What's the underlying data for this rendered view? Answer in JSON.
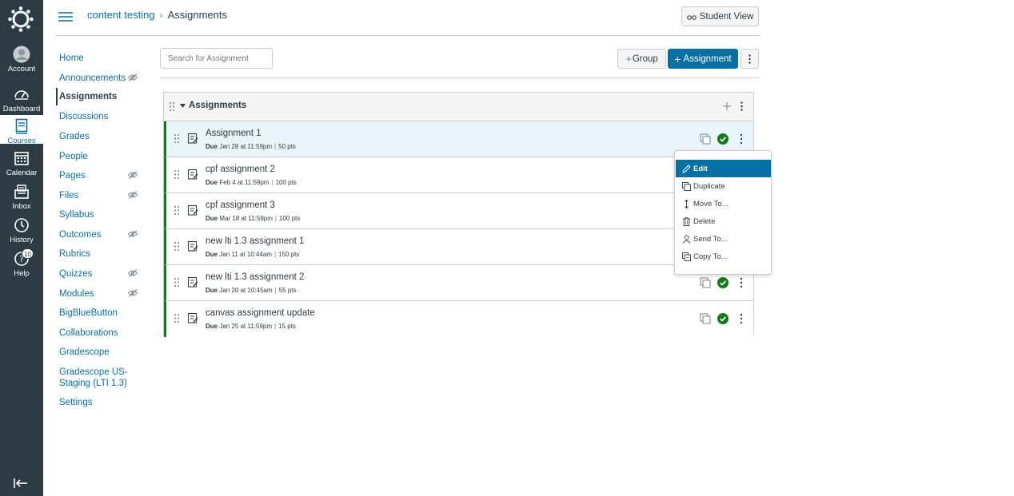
{
  "global_nav": {
    "items": [
      {
        "label": "Account",
        "icon": "account-icon"
      },
      {
        "label": "Dashboard",
        "icon": "dashboard-icon"
      },
      {
        "label": "Courses",
        "icon": "courses-icon",
        "active": true
      },
      {
        "label": "Calendar",
        "icon": "calendar-icon"
      },
      {
        "label": "Inbox",
        "icon": "inbox-icon"
      },
      {
        "label": "History",
        "icon": "history-icon"
      },
      {
        "label": "Help",
        "icon": "help-icon",
        "badge": "10"
      }
    ]
  },
  "header": {
    "course_name": "content testing",
    "separator": "›",
    "page": "Assignments",
    "student_view_label": "Student View"
  },
  "course_nav": {
    "items": [
      {
        "label": "Home"
      },
      {
        "label": "Announcements",
        "hidden": true
      },
      {
        "label": "Assignments",
        "active": true
      },
      {
        "label": "Discussions"
      },
      {
        "label": "Grades"
      },
      {
        "label": "People"
      },
      {
        "label": "Pages",
        "hidden": true
      },
      {
        "label": "Files",
        "hidden": true
      },
      {
        "label": "Syllabus"
      },
      {
        "label": "Outcomes",
        "hidden": true
      },
      {
        "label": "Rubrics"
      },
      {
        "label": "Quizzes",
        "hidden": true
      },
      {
        "label": "Modules",
        "hidden": true
      },
      {
        "label": "BigBlueButton"
      },
      {
        "label": "Collaborations"
      },
      {
        "label": "Gradescope"
      },
      {
        "label": "Gradescope US-Staging (LTI 1.3)"
      },
      {
        "label": "Settings"
      }
    ]
  },
  "toolbar": {
    "search_placeholder": "Search for Assignment",
    "group_button": "Group",
    "assignment_button": "Assignment"
  },
  "group": {
    "title": "Assignments",
    "assignments": [
      {
        "name": "Assignment 1",
        "due_label": "Due",
        "due": "Jan 28 at 11:59pm",
        "points": "50 pts",
        "highlighted": true
      },
      {
        "name": "cpf assignment 2",
        "due_label": "Due",
        "due": "Feb 4 at 11:59pm",
        "points": "100 pts"
      },
      {
        "name": "cpf assignment 3",
        "due_label": "Due",
        "due": "Mar 18 at 11:59pm",
        "points": "100 pts"
      },
      {
        "name": "new lti 1.3 assignment 1",
        "due_label": "Due",
        "due": "Jan 11 at 10:44am",
        "points": "150 pts"
      },
      {
        "name": "new lti 1.3 assignment 2",
        "due_label": "Due",
        "due": "Jan 20 at 10:45am",
        "points": "55 pts"
      },
      {
        "name": "canvas assignment update",
        "due_label": "Due",
        "due": "Jan 25 at 11:59pm",
        "points": "15 pts"
      }
    ]
  },
  "menu": {
    "items": [
      {
        "label": "Edit",
        "icon": "pencil-icon",
        "active": true
      },
      {
        "label": "Duplicate",
        "icon": "duplicate-icon"
      },
      {
        "label": "Move To...",
        "icon": "move-icon"
      },
      {
        "label": "Delete",
        "icon": "trash-icon"
      },
      {
        "label": "Send To...",
        "icon": "user-icon"
      },
      {
        "label": "Copy To...",
        "icon": "copy-icon"
      }
    ]
  },
  "colors": {
    "nav_bg": "#2d3b45",
    "brand": "#0770a3",
    "published": "#127a1b",
    "highlight_row": "#eaf5fb"
  }
}
